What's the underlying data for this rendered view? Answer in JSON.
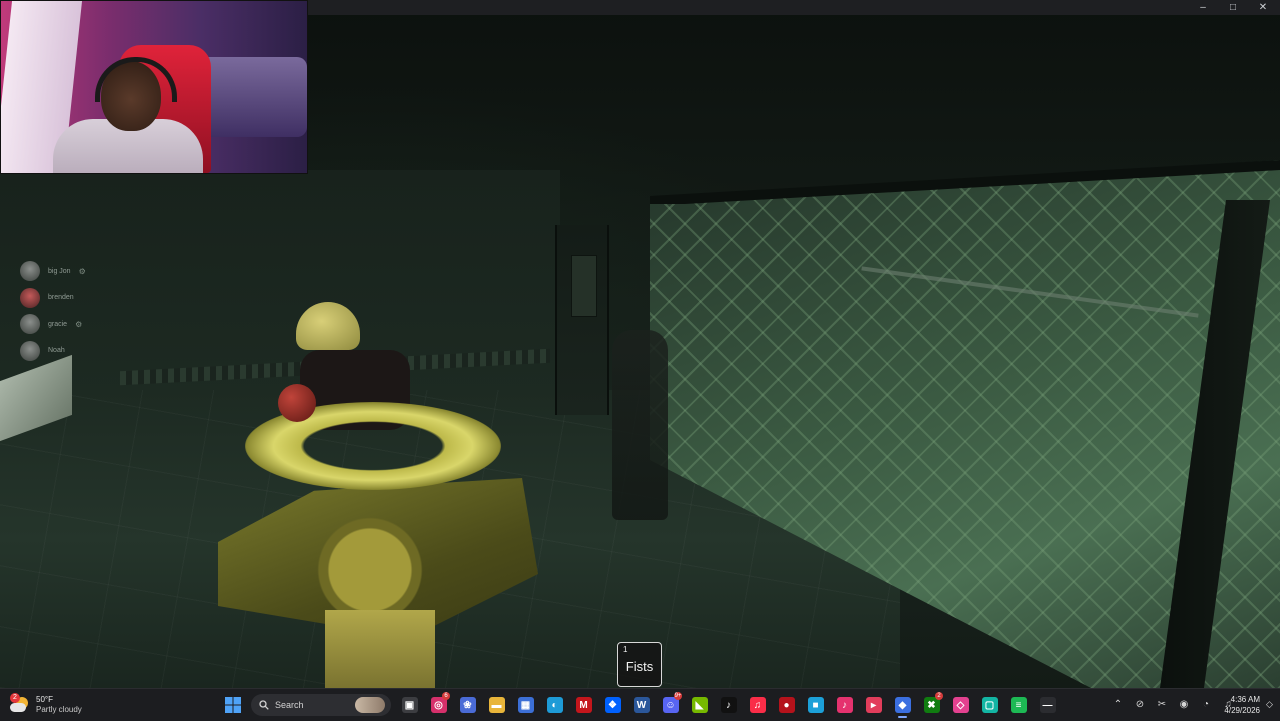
{
  "window": {
    "controls": [
      "–",
      "□",
      "✕"
    ]
  },
  "players": [
    {
      "name": "big Jon",
      "badge": "⚙"
    },
    {
      "name": "brenden",
      "badge": ""
    },
    {
      "name": "gracie",
      "badge": "⚙"
    },
    {
      "name": "Noah",
      "badge": ""
    }
  ],
  "hotbar": {
    "slot_number": "1",
    "item_label": "Fists"
  },
  "weather": {
    "badge": "2",
    "temperature": "50°F",
    "condition": "Partly cloudy"
  },
  "taskbar": {
    "search_label": "Search",
    "apps": [
      {
        "name": "task-view",
        "glyph": "▣",
        "color": "#3c3d41"
      },
      {
        "name": "instagram",
        "glyph": "◎",
        "color": "#d6306b",
        "badge": "6"
      },
      {
        "name": "copilot",
        "glyph": "❀",
        "color": "#4a6bd6"
      },
      {
        "name": "file-explorer",
        "glyph": "▬",
        "color": "#e8b53a"
      },
      {
        "name": "microsoft-store",
        "glyph": "▦",
        "color": "#3c6fd6"
      },
      {
        "name": "edge",
        "glyph": "◐",
        "color": "#1e9bd7"
      },
      {
        "name": "mcafee",
        "glyph": "M",
        "color": "#c4161c"
      },
      {
        "name": "dropbox",
        "glyph": "❖",
        "color": "#0061fe"
      },
      {
        "name": "word",
        "glyph": "W",
        "color": "#2b579a"
      },
      {
        "name": "discord",
        "glyph": "☺",
        "color": "#5865f2",
        "badge": "9+"
      },
      {
        "name": "nvidia",
        "glyph": "◣",
        "color": "#76b900"
      },
      {
        "name": "tiktok",
        "glyph": "♪",
        "color": "#111111"
      },
      {
        "name": "apple-music",
        "glyph": "♫",
        "color": "#fa2d48"
      },
      {
        "name": "red-app",
        "glyph": "●",
        "color": "#b5121b"
      },
      {
        "name": "blue-app",
        "glyph": "■",
        "color": "#1ca0d8"
      },
      {
        "name": "tiktok-studio",
        "glyph": "♪",
        "color": "#e5326e"
      },
      {
        "name": "streamlabs",
        "glyph": "▸",
        "color": "#e23d5b"
      },
      {
        "name": "roblox",
        "glyph": "◆",
        "color": "#3b6fe0",
        "active": true
      },
      {
        "name": "xbox",
        "glyph": "✖",
        "color": "#107c10",
        "badge": "2"
      },
      {
        "name": "pink-app",
        "glyph": "◇",
        "color": "#e3418f"
      },
      {
        "name": "teal-app",
        "glyph": "▢",
        "color": "#13b5a3"
      },
      {
        "name": "spotify",
        "glyph": "≡",
        "color": "#1db954"
      },
      {
        "name": "terminal",
        "glyph": "—",
        "color": "#2b2c30"
      }
    ]
  },
  "tray": {
    "icons": [
      "⌃",
      "⊘",
      "✂",
      "◉",
      "◔",
      "♫"
    ]
  },
  "clock": {
    "time": "4:36 AM",
    "date": "4/29/2026"
  }
}
